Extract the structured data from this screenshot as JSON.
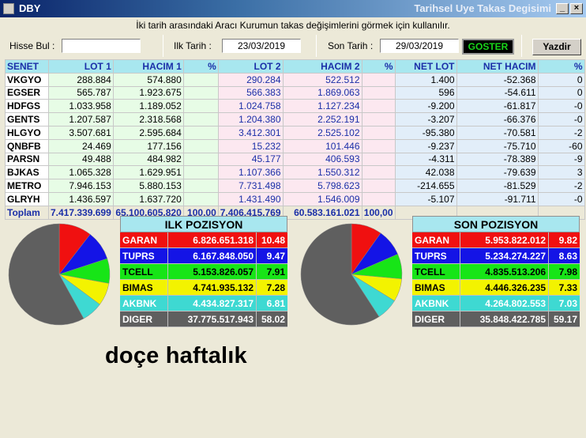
{
  "window": {
    "app_title": "DBY",
    "title": "Tarihsel Uye Takas Degisimi",
    "minimize_label": "_",
    "close_label": "×"
  },
  "hint": "İki tarih arasındaki Aracı Kurumun takas değişimlerini görmek için kullanılır.",
  "controls": {
    "hisse_label": "Hisse Bul :",
    "hisse_value": "",
    "ilk_tarih_label": "Ilk Tarih :",
    "ilk_tarih_value": "23/03/2019",
    "son_tarih_label": "Son Tarih :",
    "son_tarih_value": "29/03/2019",
    "goster_label": "GOSTER",
    "yazdir_label": "Yazdir"
  },
  "table": {
    "headers": [
      "SENET",
      "LOT 1",
      "HACIM 1",
      "%",
      "LOT 2",
      "HACIM 2",
      "%",
      "NET LOT",
      "NET HACIM",
      "%"
    ],
    "rows": [
      [
        "VKGYO",
        "288.884",
        "574.880",
        "",
        "290.284",
        "522.512",
        "",
        "1.400",
        "-52.368",
        "0"
      ],
      [
        "EGSER",
        "565.787",
        "1.923.675",
        "",
        "566.383",
        "1.869.063",
        "",
        "596",
        "-54.611",
        "0"
      ],
      [
        "HDFGS",
        "1.033.958",
        "1.189.052",
        "",
        "1.024.758",
        "1.127.234",
        "",
        "-9.200",
        "-61.817",
        "-0"
      ],
      [
        "GENTS",
        "1.207.587",
        "2.318.568",
        "",
        "1.204.380",
        "2.252.191",
        "",
        "-3.207",
        "-66.376",
        "-0"
      ],
      [
        "HLGYO",
        "3.507.681",
        "2.595.684",
        "",
        "3.412.301",
        "2.525.102",
        "",
        "-95.380",
        "-70.581",
        "-2"
      ],
      [
        "QNBFB",
        "24.469",
        "177.156",
        "",
        "15.232",
        "101.446",
        "",
        "-9.237",
        "-75.710",
        "-60"
      ],
      [
        "PARSN",
        "49.488",
        "484.982",
        "",
        "45.177",
        "406.593",
        "",
        "-4.311",
        "-78.389",
        "-9"
      ],
      [
        "BJKAS",
        "1.065.328",
        "1.629.951",
        "",
        "1.107.366",
        "1.550.312",
        "",
        "42.038",
        "-79.639",
        "3"
      ],
      [
        "METRO",
        "7.946.153",
        "5.880.153",
        "",
        "7.731.498",
        "5.798.623",
        "",
        "-214.655",
        "-81.529",
        "-2"
      ],
      [
        "GLRYH",
        "1.436.597",
        "1.637.720",
        "",
        "1.431.490",
        "1.546.009",
        "",
        "-5.107",
        "-91.711",
        "-0"
      ]
    ],
    "total": [
      "Toplam",
      "7.417.339.699",
      "65.100.605.820",
      "100,00",
      "7.406.415.769",
      "60.583.161.021",
      "100,00",
      "",
      "",
      ""
    ]
  },
  "ilk_pozisyon": {
    "title": "ILK POZISYON",
    "rows": [
      {
        "name": "GARAN",
        "value": "6.826.651.318",
        "pct": "10.48",
        "color": "#f01010"
      },
      {
        "name": "TUPRS",
        "value": "6.167.848.050",
        "pct": "9.47",
        "color": "#1414e6"
      },
      {
        "name": "TCELL",
        "value": "5.153.826.057",
        "pct": "7.91",
        "color": "#17e517"
      },
      {
        "name": "BIMAS",
        "value": "4.741.935.132",
        "pct": "7.28",
        "color": "#f3f300"
      },
      {
        "name": "AKBNK",
        "value": "4.434.827.317",
        "pct": "6.81",
        "color": "#3ed9d2"
      },
      {
        "name": "DIGER",
        "value": "37.775.517.943",
        "pct": "58.02",
        "color": "#5f5f5f"
      }
    ]
  },
  "son_pozisyon": {
    "title": "SON POZISYON",
    "rows": [
      {
        "name": "GARAN",
        "value": "5.953.822.012",
        "pct": "9.82",
        "color": "#f01010"
      },
      {
        "name": "TUPRS",
        "value": "5.234.274.227",
        "pct": "8.63",
        "color": "#1414e6"
      },
      {
        "name": "TCELL",
        "value": "4.835.513.206",
        "pct": "7.98",
        "color": "#17e517"
      },
      {
        "name": "BIMAS",
        "value": "4.446.326.235",
        "pct": "7.33",
        "color": "#f3f300"
      },
      {
        "name": "AKBNK",
        "value": "4.264.802.553",
        "pct": "7.03",
        "color": "#3ed9d2"
      },
      {
        "name": "DIGER",
        "value": "35.848.422.785",
        "pct": "59.17",
        "color": "#5f5f5f"
      }
    ]
  },
  "caption": "doçe haftalık"
}
